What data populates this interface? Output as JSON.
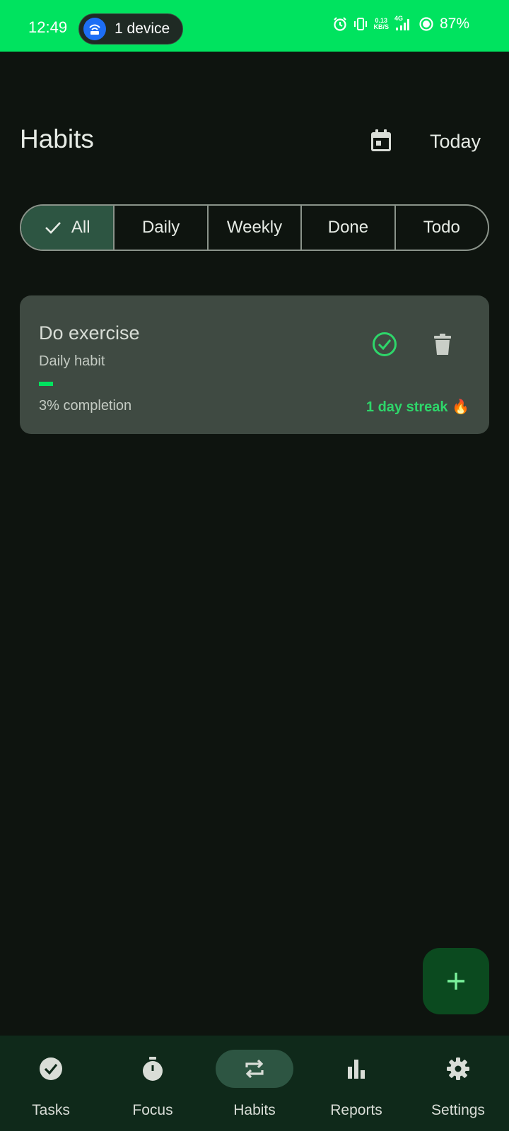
{
  "status_bar": {
    "time": "12:49",
    "hotspot_label": "1 device",
    "net_speed_value": "0.13",
    "net_speed_unit": "KB/S",
    "network_type": "4G",
    "battery": "87%",
    "colors": {
      "background": "#00e35f"
    }
  },
  "header": {
    "title": "Habits",
    "calendar_icon": "calendar-icon",
    "today_label": "Today"
  },
  "filters": {
    "items": [
      {
        "label": "All",
        "selected": true
      },
      {
        "label": "Daily",
        "selected": false
      },
      {
        "label": "Weekly",
        "selected": false
      },
      {
        "label": "Done",
        "selected": false
      },
      {
        "label": "Todo",
        "selected": false
      }
    ]
  },
  "habits": [
    {
      "title": "Do exercise",
      "subtitle": "Daily habit",
      "completion_fraction": 0.03,
      "completion_label": "3% completion",
      "streak_label": "1 day streak 🔥"
    }
  ],
  "fab": {
    "icon": "plus-icon"
  },
  "bottom_nav": {
    "items": [
      {
        "label": "Tasks",
        "icon": "check-circle-icon",
        "active": false
      },
      {
        "label": "Focus",
        "icon": "timer-icon",
        "active": false
      },
      {
        "label": "Habits",
        "icon": "repeat-icon",
        "active": true
      },
      {
        "label": "Reports",
        "icon": "bar-chart-icon",
        "active": false
      },
      {
        "label": "Settings",
        "icon": "gear-icon",
        "active": false
      }
    ]
  },
  "colors": {
    "accent": "#00e35f",
    "background": "#0e140f",
    "card": "#3f4a42",
    "selected": "#2d5542",
    "streak": "#2ed66a"
  }
}
